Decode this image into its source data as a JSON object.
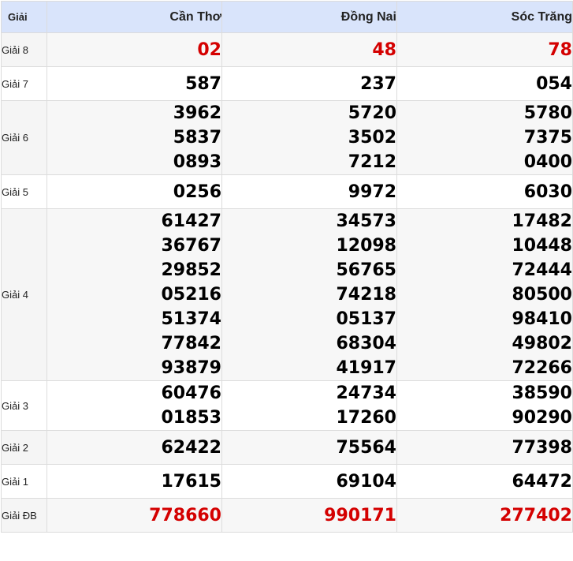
{
  "header": {
    "prize_label": "Giải",
    "provinces": [
      "Cần Thơ",
      "Đồng Nai",
      "Sóc Trăng"
    ]
  },
  "rows": [
    {
      "label": "Giải 8",
      "highlight": true,
      "values": [
        [
          "02"
        ],
        [
          "48"
        ],
        [
          "78"
        ]
      ]
    },
    {
      "label": "Giải 7",
      "highlight": false,
      "values": [
        [
          "587"
        ],
        [
          "237"
        ],
        [
          "054"
        ]
      ]
    },
    {
      "label": "Giải 6",
      "highlight": false,
      "values": [
        [
          "3962",
          "5837",
          "0893"
        ],
        [
          "5720",
          "3502",
          "7212"
        ],
        [
          "5780",
          "7375",
          "0400"
        ]
      ]
    },
    {
      "label": "Giải 5",
      "highlight": false,
      "values": [
        [
          "0256"
        ],
        [
          "9972"
        ],
        [
          "6030"
        ]
      ]
    },
    {
      "label": "Giải 4",
      "highlight": false,
      "values": [
        [
          "61427",
          "36767",
          "29852",
          "05216",
          "51374",
          "77842",
          "93879"
        ],
        [
          "34573",
          "12098",
          "56765",
          "74218",
          "05137",
          "68304",
          "41917"
        ],
        [
          "17482",
          "10448",
          "72444",
          "80500",
          "98410",
          "49802",
          "72266"
        ]
      ]
    },
    {
      "label": "Giải 3",
      "highlight": false,
      "values": [
        [
          "60476",
          "01853"
        ],
        [
          "24734",
          "17260"
        ],
        [
          "38590",
          "90290"
        ]
      ]
    },
    {
      "label": "Giải 2",
      "highlight": false,
      "values": [
        [
          "62422"
        ],
        [
          "75564"
        ],
        [
          "77398"
        ]
      ]
    },
    {
      "label": "Giải 1",
      "highlight": false,
      "values": [
        [
          "17615"
        ],
        [
          "69104"
        ],
        [
          "64472"
        ]
      ]
    },
    {
      "label": "Giải ĐB",
      "highlight": true,
      "values": [
        [
          "778660"
        ],
        [
          "990171"
        ],
        [
          "277402"
        ]
      ]
    }
  ],
  "colors": {
    "header_bg": "#d9e4fb",
    "highlight_number": "#d40000",
    "normal_number": "#000000",
    "alt_row_bg": "#f5f5f5",
    "border": "#dcdcdc"
  }
}
